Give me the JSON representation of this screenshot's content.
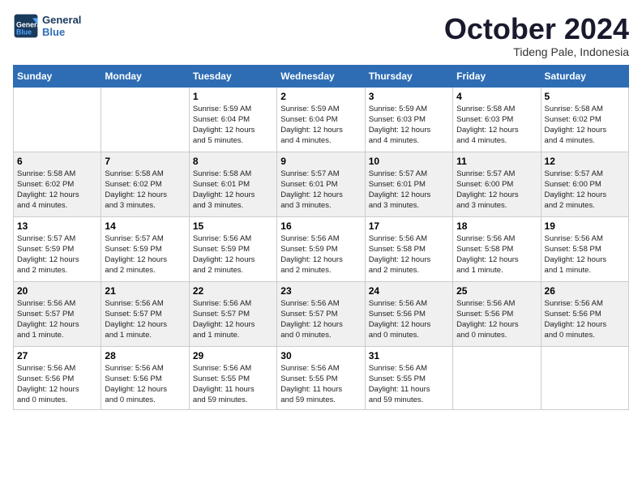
{
  "header": {
    "logo_line1": "General",
    "logo_line2": "Blue",
    "month_title": "October 2024",
    "location": "Tideng Pale, Indonesia"
  },
  "weekdays": [
    "Sunday",
    "Monday",
    "Tuesday",
    "Wednesday",
    "Thursday",
    "Friday",
    "Saturday"
  ],
  "weeks": [
    [
      {
        "day": "",
        "info": ""
      },
      {
        "day": "",
        "info": ""
      },
      {
        "day": "1",
        "info": "Sunrise: 5:59 AM\nSunset: 6:04 PM\nDaylight: 12 hours\nand 5 minutes."
      },
      {
        "day": "2",
        "info": "Sunrise: 5:59 AM\nSunset: 6:04 PM\nDaylight: 12 hours\nand 4 minutes."
      },
      {
        "day": "3",
        "info": "Sunrise: 5:59 AM\nSunset: 6:03 PM\nDaylight: 12 hours\nand 4 minutes."
      },
      {
        "day": "4",
        "info": "Sunrise: 5:58 AM\nSunset: 6:03 PM\nDaylight: 12 hours\nand 4 minutes."
      },
      {
        "day": "5",
        "info": "Sunrise: 5:58 AM\nSunset: 6:02 PM\nDaylight: 12 hours\nand 4 minutes."
      }
    ],
    [
      {
        "day": "6",
        "info": "Sunrise: 5:58 AM\nSunset: 6:02 PM\nDaylight: 12 hours\nand 4 minutes."
      },
      {
        "day": "7",
        "info": "Sunrise: 5:58 AM\nSunset: 6:02 PM\nDaylight: 12 hours\nand 3 minutes."
      },
      {
        "day": "8",
        "info": "Sunrise: 5:58 AM\nSunset: 6:01 PM\nDaylight: 12 hours\nand 3 minutes."
      },
      {
        "day": "9",
        "info": "Sunrise: 5:57 AM\nSunset: 6:01 PM\nDaylight: 12 hours\nand 3 minutes."
      },
      {
        "day": "10",
        "info": "Sunrise: 5:57 AM\nSunset: 6:01 PM\nDaylight: 12 hours\nand 3 minutes."
      },
      {
        "day": "11",
        "info": "Sunrise: 5:57 AM\nSunset: 6:00 PM\nDaylight: 12 hours\nand 3 minutes."
      },
      {
        "day": "12",
        "info": "Sunrise: 5:57 AM\nSunset: 6:00 PM\nDaylight: 12 hours\nand 2 minutes."
      }
    ],
    [
      {
        "day": "13",
        "info": "Sunrise: 5:57 AM\nSunset: 5:59 PM\nDaylight: 12 hours\nand 2 minutes."
      },
      {
        "day": "14",
        "info": "Sunrise: 5:57 AM\nSunset: 5:59 PM\nDaylight: 12 hours\nand 2 minutes."
      },
      {
        "day": "15",
        "info": "Sunrise: 5:56 AM\nSunset: 5:59 PM\nDaylight: 12 hours\nand 2 minutes."
      },
      {
        "day": "16",
        "info": "Sunrise: 5:56 AM\nSunset: 5:59 PM\nDaylight: 12 hours\nand 2 minutes."
      },
      {
        "day": "17",
        "info": "Sunrise: 5:56 AM\nSunset: 5:58 PM\nDaylight: 12 hours\nand 2 minutes."
      },
      {
        "day": "18",
        "info": "Sunrise: 5:56 AM\nSunset: 5:58 PM\nDaylight: 12 hours\nand 1 minute."
      },
      {
        "day": "19",
        "info": "Sunrise: 5:56 AM\nSunset: 5:58 PM\nDaylight: 12 hours\nand 1 minute."
      }
    ],
    [
      {
        "day": "20",
        "info": "Sunrise: 5:56 AM\nSunset: 5:57 PM\nDaylight: 12 hours\nand 1 minute."
      },
      {
        "day": "21",
        "info": "Sunrise: 5:56 AM\nSunset: 5:57 PM\nDaylight: 12 hours\nand 1 minute."
      },
      {
        "day": "22",
        "info": "Sunrise: 5:56 AM\nSunset: 5:57 PM\nDaylight: 12 hours\nand 1 minute."
      },
      {
        "day": "23",
        "info": "Sunrise: 5:56 AM\nSunset: 5:57 PM\nDaylight: 12 hours\nand 0 minutes."
      },
      {
        "day": "24",
        "info": "Sunrise: 5:56 AM\nSunset: 5:56 PM\nDaylight: 12 hours\nand 0 minutes."
      },
      {
        "day": "25",
        "info": "Sunrise: 5:56 AM\nSunset: 5:56 PM\nDaylight: 12 hours\nand 0 minutes."
      },
      {
        "day": "26",
        "info": "Sunrise: 5:56 AM\nSunset: 5:56 PM\nDaylight: 12 hours\nand 0 minutes."
      }
    ],
    [
      {
        "day": "27",
        "info": "Sunrise: 5:56 AM\nSunset: 5:56 PM\nDaylight: 12 hours\nand 0 minutes."
      },
      {
        "day": "28",
        "info": "Sunrise: 5:56 AM\nSunset: 5:56 PM\nDaylight: 12 hours\nand 0 minutes."
      },
      {
        "day": "29",
        "info": "Sunrise: 5:56 AM\nSunset: 5:55 PM\nDaylight: 11 hours\nand 59 minutes."
      },
      {
        "day": "30",
        "info": "Sunrise: 5:56 AM\nSunset: 5:55 PM\nDaylight: 11 hours\nand 59 minutes."
      },
      {
        "day": "31",
        "info": "Sunrise: 5:56 AM\nSunset: 5:55 PM\nDaylight: 11 hours\nand 59 minutes."
      },
      {
        "day": "",
        "info": ""
      },
      {
        "day": "",
        "info": ""
      }
    ]
  ]
}
